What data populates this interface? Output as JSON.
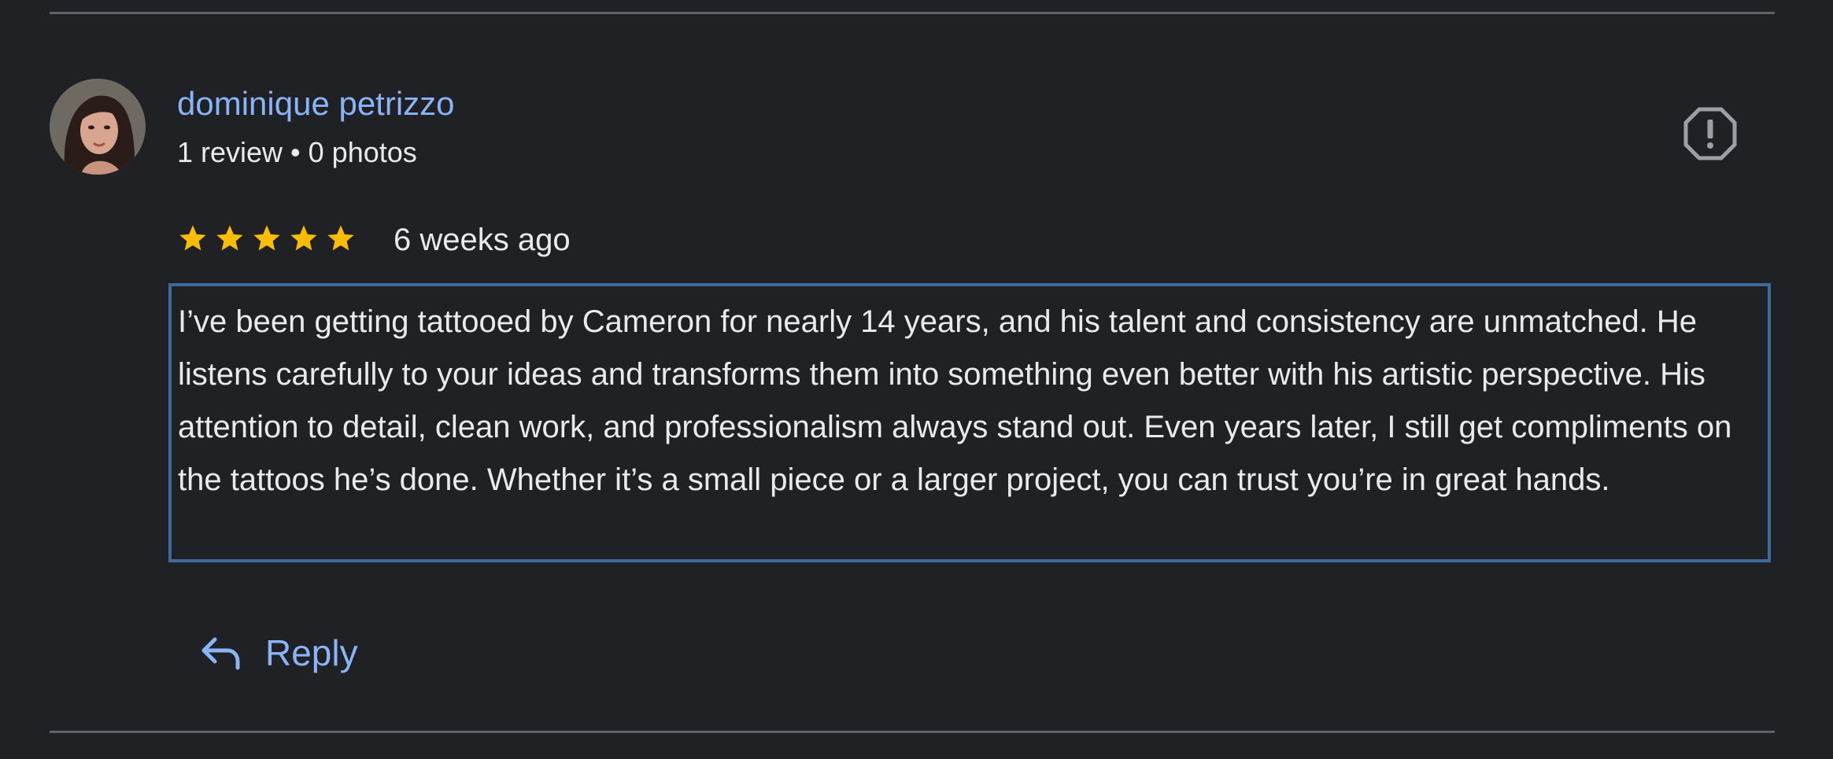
{
  "review": {
    "reviewer_name": "dominique petrizzo",
    "reviewer_meta": "1 review • 0 photos",
    "rating": 5,
    "rating_max": 5,
    "date": "6 weeks ago",
    "text": "I’ve been getting tattooed by Cameron for nearly 14 years, and his talent and consistency are unmatched. He listens carefully to your ideas and transforms them into something even better with his artistic perspective. His attention to detail, clean work, and professionalism always stand out. Even years later, I still get compliments on the tattoos he’s done. Whether it’s a small piece or a larger project, you can trust you’re in great hands.",
    "reply_label": "Reply"
  },
  "icons": {
    "flag": "report-icon",
    "reply": "reply-icon",
    "star": "star-icon"
  },
  "colors": {
    "background": "#202124",
    "link": "#8ab4f8",
    "text": "#e8eaed",
    "star": "#fbbc04",
    "text_box_border": "#3c6a9c",
    "divider": "#5f6368"
  }
}
